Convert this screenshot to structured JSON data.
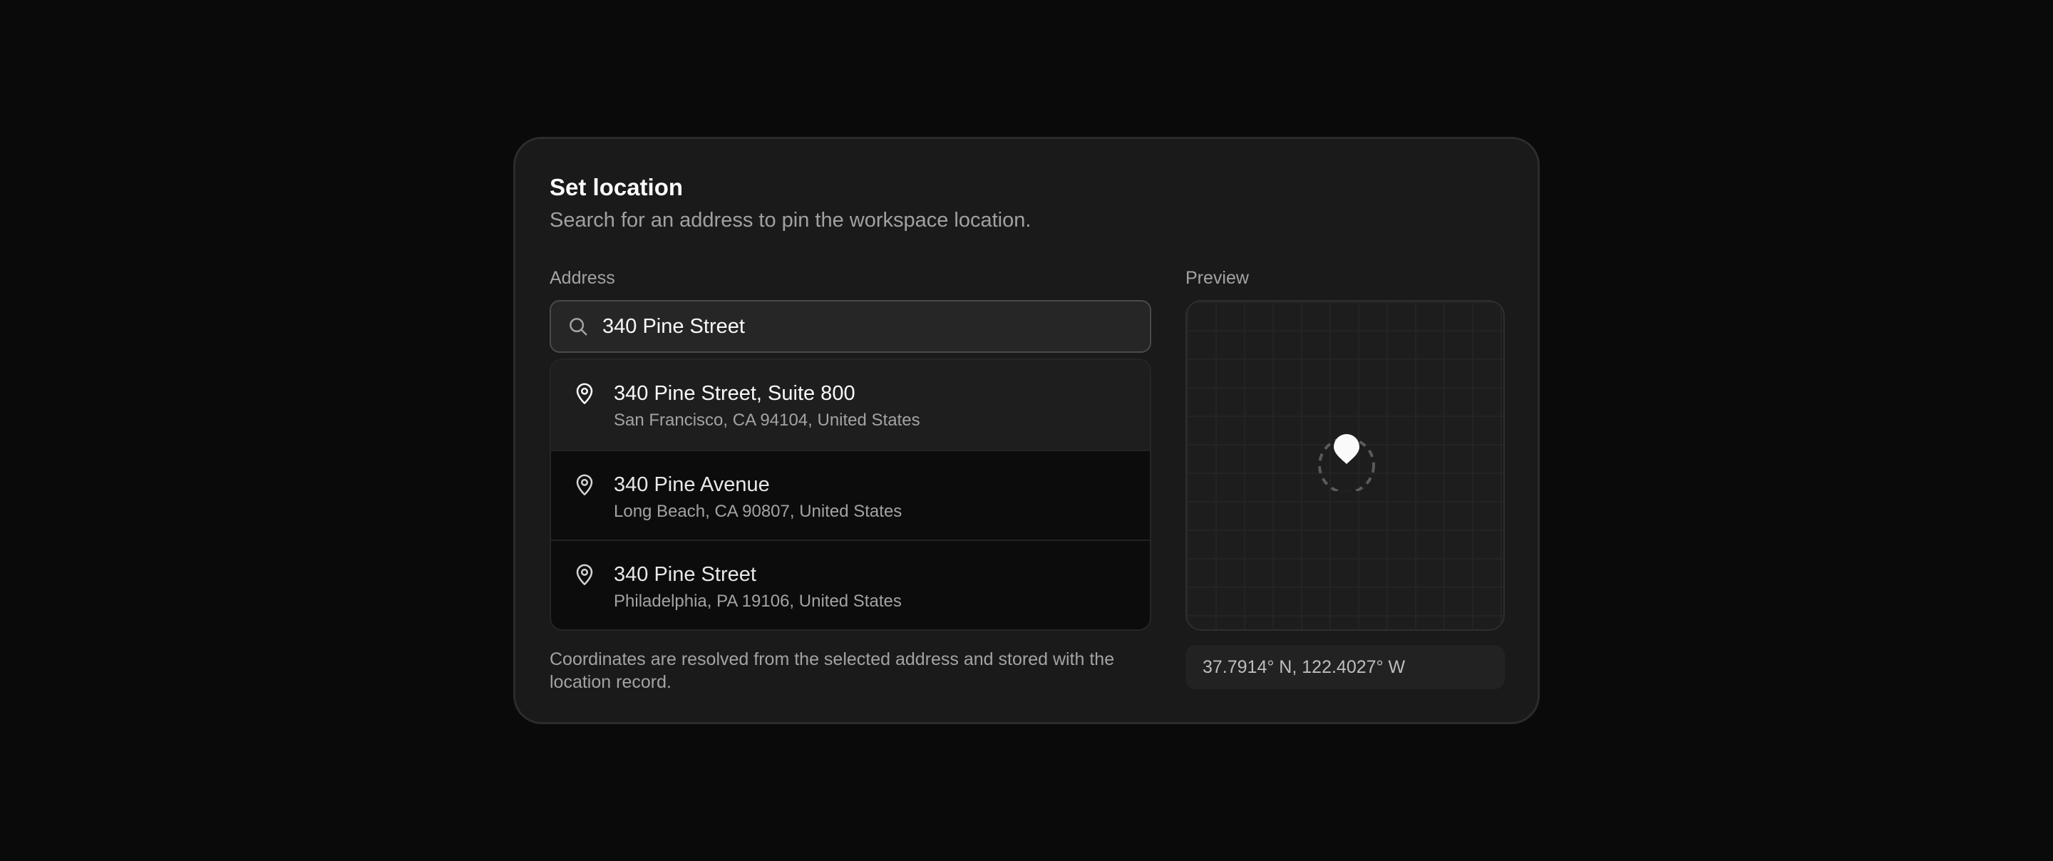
{
  "dialog": {
    "title": "Set location",
    "subtitle": "Search for an address to pin the workspace location."
  },
  "address": {
    "label": "Address",
    "search_value": "340 Pine Street",
    "search_icon": "search-icon"
  },
  "results": [
    {
      "name": "340 Pine Street, Suite 800",
      "detail": "San Francisco, CA 94104, United States",
      "icon": "map-pin-icon",
      "highlighted": true
    },
    {
      "name": "340 Pine Avenue",
      "detail": "Long Beach, CA 90807, United States",
      "icon": "map-pin-icon",
      "highlighted": false
    },
    {
      "name": "340 Pine Street",
      "detail": "Philadelphia, PA 19106, United States",
      "icon": "map-pin-icon",
      "highlighted": false
    }
  ],
  "note": "Coordinates are resolved from the selected address and stored with the location record.",
  "preview": {
    "label": "Preview",
    "coordinates": "37.7914° N, 122.4027° W"
  },
  "colors": {
    "background": "#0a0a0a",
    "card": "#1a1a1a",
    "highlight": "#1e1e1e",
    "muted_text": "#a3a3a3"
  }
}
